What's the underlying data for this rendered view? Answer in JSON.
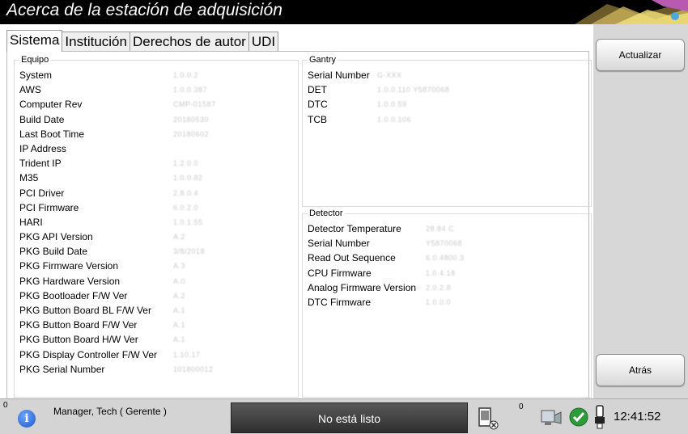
{
  "window": {
    "title": "Acerca de la estación de adquisición"
  },
  "tabs": [
    {
      "label": "Sistema"
    },
    {
      "label": "Institución"
    },
    {
      "label": "Derechos de autor"
    },
    {
      "label": "UDI"
    }
  ],
  "equipo": {
    "legend": "Equipo",
    "rows": [
      {
        "label": "System",
        "value": "1.0.0.2"
      },
      {
        "label": "AWS",
        "value": "1.0.0.387"
      },
      {
        "label": "Computer Rev",
        "value": "CMP-01587"
      },
      {
        "label": "Build Date",
        "value": "20180530"
      },
      {
        "label": "Last Boot Time",
        "value": "20180602"
      },
      {
        "label": "IP Address",
        "value": ""
      },
      {
        "label": "Trident IP",
        "value": "1.2.0.0"
      },
      {
        "label": "M35",
        "value": "1.0.0.82"
      },
      {
        "label": "PCI Driver",
        "value": "2.8.0.4"
      },
      {
        "label": "PCI Firmware",
        "value": "6.0.2.0"
      },
      {
        "label": "HARI",
        "value": "1.0.1.55"
      },
      {
        "label": "PKG API Version",
        "value": "A.2"
      },
      {
        "label": "PKG Build Date",
        "value": "3/8/2018"
      },
      {
        "label": "PKG Firmware Version",
        "value": "A.3"
      },
      {
        "label": "PKG Hardware Version",
        "value": "A.0"
      },
      {
        "label": "PKG Bootloader F/W Ver",
        "value": "A.2"
      },
      {
        "label": "PKG Button Board BL F/W Ver",
        "value": "A.1"
      },
      {
        "label": "PKG Button Board F/W Ver",
        "value": "A.1"
      },
      {
        "label": "PKG Button Board H/W Ver",
        "value": "A.1"
      },
      {
        "label": "PKG Display Controller F/W Ver",
        "value": "1.10.17"
      },
      {
        "label": "PKG Serial Number",
        "value": "101800012"
      }
    ]
  },
  "gantry": {
    "legend": "Gantry",
    "rows": [
      {
        "label": "Serial Number",
        "value": "G-XXX"
      },
      {
        "label": "DET",
        "value": "1.0.0.110   Y5870068"
      },
      {
        "label": "DTC",
        "value": "1.0.0.59"
      },
      {
        "label": "TCB",
        "value": "1.0.0.106"
      }
    ]
  },
  "detector": {
    "legend": "Detector",
    "rows": [
      {
        "label": "Detector Temperature",
        "value": "28.84 C"
      },
      {
        "label": "Serial Number",
        "value": "Y5870068"
      },
      {
        "label": "Read Out Sequence",
        "value": "6.0.4800.3"
      },
      {
        "label": "CPU Firmware",
        "value": "1.0.4.18"
      },
      {
        "label": "Analog Firmware Version",
        "value": "2.0.2.8"
      },
      {
        "label": "DTC Firmware",
        "value": "1.0.0.0"
      }
    ]
  },
  "buttons": {
    "update": "Actualizar",
    "back": "Atrás"
  },
  "taskbar": {
    "count_left": "0",
    "user": "Manager, Tech ( Gerente )",
    "status": "No está listo",
    "count_right": "0",
    "clock": "12:41:52",
    "icons": [
      "info-icon",
      "detector-disconnected-icon",
      "network-icon",
      "ok-check-icon",
      "tube-icon"
    ]
  }
}
